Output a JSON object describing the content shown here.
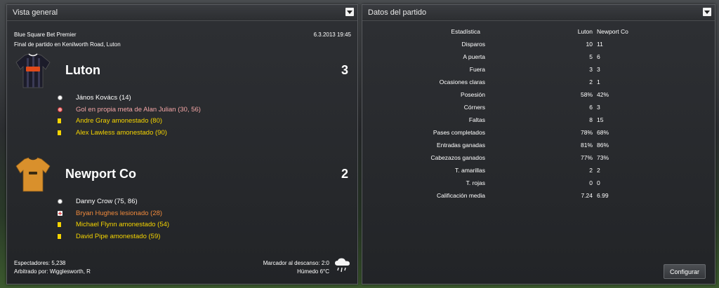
{
  "overview": {
    "title": "Vista general",
    "competition": "Blue Square Bet Premier",
    "datetime": "6.3.2013 19:45",
    "venue": "Final de partido en Kenilworth Road, Luton",
    "home": {
      "name": "Luton",
      "score": "3",
      "events": [
        {
          "type": "goal",
          "text": "János Kovács (14)",
          "color": "#ffffff"
        },
        {
          "type": "own-goal",
          "text": "Gol en propia meta de Alan Julian (30, 56)",
          "color": "#f4a6a6"
        },
        {
          "type": "yellow",
          "text": "Andre Gray amonestado (80)",
          "color": "#f5d400"
        },
        {
          "type": "yellow",
          "text": "Alex Lawless amonestado (90)",
          "color": "#f5d400"
        }
      ]
    },
    "away": {
      "name": "Newport Co",
      "score": "2",
      "events": [
        {
          "type": "goal",
          "text": "Danny Crow (75, 86)",
          "color": "#ffffff"
        },
        {
          "type": "injury",
          "text": "Bryan Hughes lesionado (28)",
          "color": "#f08a3c"
        },
        {
          "type": "yellow",
          "text": "Michael Flynn amonestado (54)",
          "color": "#f5d400"
        },
        {
          "type": "yellow",
          "text": "David Pipe amonestado (59)",
          "color": "#f5d400"
        }
      ]
    },
    "attendance": "Espectadores: 5,238",
    "referee": "Arbitrado por: Wigglesworth, R",
    "halftime": "Marcador al descanso: 2:0",
    "weather": "Húmedo 6°C",
    "weather_icon": "rain-cloud-icon"
  },
  "stats": {
    "title": "Datos del partido",
    "header": {
      "label": "Estadística",
      "home": "Luton",
      "away": "Newport Co"
    },
    "rows": [
      {
        "label": "Disparos",
        "home": "10",
        "away": "11"
      },
      {
        "label": "A puerta",
        "home": "5",
        "away": "6"
      },
      {
        "label": "Fuera",
        "home": "3",
        "away": "3"
      },
      {
        "label": "Ocasiones claras",
        "home": "2",
        "away": "1"
      },
      {
        "label": "Posesión",
        "home": "58%",
        "away": "42%"
      },
      {
        "label": "Córners",
        "home": "6",
        "away": "3"
      },
      {
        "label": "Faltas",
        "home": "8",
        "away": "15"
      },
      {
        "label": "Pases completados",
        "home": "78%",
        "away": "68%"
      },
      {
        "label": "Entradas ganadas",
        "home": "81%",
        "away": "86%"
      },
      {
        "label": "Cabezazos ganados",
        "home": "77%",
        "away": "73%"
      },
      {
        "label": "T. amarillas",
        "home": "2",
        "away": "2"
      },
      {
        "label": "T. rojas",
        "home": "0",
        "away": "0"
      },
      {
        "label": "Calificación media",
        "home": "7.24",
        "away": "6.99"
      }
    ],
    "configure_label": "Configurar"
  }
}
